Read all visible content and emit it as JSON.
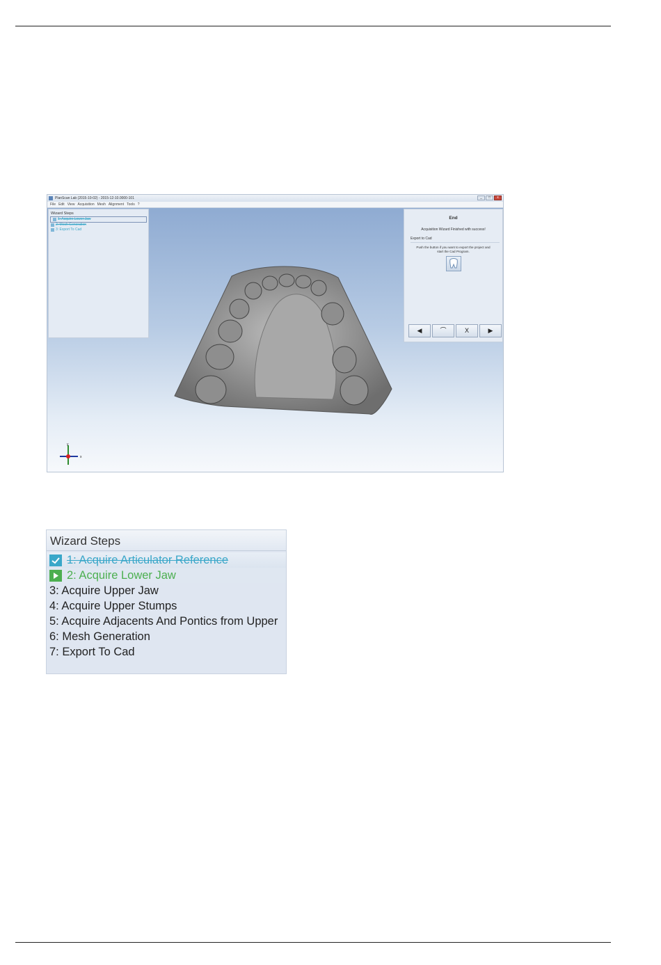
{
  "app": {
    "window_title": "PlanScan Lab (2015-10-02) - 2015-12-10.0000-101",
    "menu": [
      "File",
      "Edit",
      "View",
      "Acquisition",
      "Mesh",
      "Alignment",
      "Tools",
      "?"
    ],
    "window_buttons": [
      "_",
      "□",
      "x"
    ]
  },
  "wizard_small": {
    "title": "Wizard Steps",
    "steps": [
      {
        "label": "1: Acquire Lower Jaw",
        "state": "done"
      },
      {
        "label": "2: Mesh Generation",
        "state": "done"
      },
      {
        "label": "3: Export To Cad",
        "state": "current"
      }
    ]
  },
  "end_panel": {
    "title": "End",
    "message": "Acquisition Wizard Finished with success!",
    "section": "Export to Cad",
    "description": "Push the button if you want to export the project and start the Cad Program.",
    "nav_buttons": {
      "back": "◀",
      "undo": "⌒",
      "cancel": "X",
      "next": "▶"
    }
  },
  "axes": {
    "y": "y",
    "x": "x"
  },
  "wizard_zoom": {
    "title": "Wizard Steps",
    "steps": [
      {
        "label": "1: Acquire Articulator Reference",
        "state": "done"
      },
      {
        "label": "2: Acquire Lower Jaw",
        "state": "current"
      },
      {
        "label": "3: Acquire Upper Jaw",
        "state": "pending"
      },
      {
        "label": "4: Acquire Upper Stumps",
        "state": "pending"
      },
      {
        "label": "5: Acquire Adjacents And Pontics from Upper",
        "state": "pending"
      },
      {
        "label": "6: Mesh Generation",
        "state": "pending"
      },
      {
        "label": "7: Export To Cad",
        "state": "pending"
      }
    ]
  },
  "colors": {
    "done": "#3aa7c9",
    "current": "#4caf50",
    "viewport_top": "#8fabd2",
    "panel": "#e4ebf4"
  }
}
